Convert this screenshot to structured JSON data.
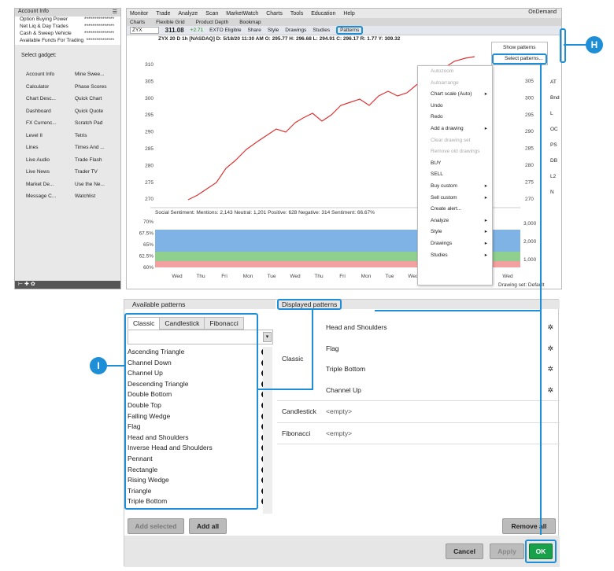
{
  "left_panel": {
    "header": "Account Info",
    "account_rows": [
      {
        "label": "Option Buying Power",
        "value": "***************"
      },
      {
        "label": "Net Liq & Day Trades",
        "value": "***************"
      },
      {
        "label": "Cash & Sweep Vehicle",
        "value": "***************"
      },
      {
        "label": "Available Funds For Trading",
        "value": "**************"
      }
    ],
    "select_gadget": "Select gadget:",
    "gadgets": [
      "Account Info",
      "Mine Swee...",
      "Calculator",
      "Phase Scores",
      "Chart Desc...",
      "Quick Chart",
      "Dashboard",
      "Quick Quote",
      "FX Currenc...",
      "Scratch Pad",
      "Level II",
      "Tetris",
      "Lines",
      "Times And ...",
      "Live Audio",
      "Trade Flash",
      "Live News",
      "Trader TV",
      "Market De...",
      "Use the Ne...",
      "Message C...",
      "Watchlist"
    ]
  },
  "chart": {
    "menu": [
      "Monitor",
      "Trade",
      "Analyze",
      "Scan",
      "MarketWatch",
      "Charts",
      "Tools",
      "Education",
      "Help"
    ],
    "ondemand": "OnDemand",
    "subtabs": [
      "Charts",
      "Flexible Grid",
      "Product Depth",
      "Bookmap"
    ],
    "symbol": "ZYX",
    "price": "311.08",
    "change": "+2.71",
    "toolbar": [
      "EXTO Eligible",
      "Share",
      "Style",
      "Drawings",
      "Studies",
      "Patterns"
    ],
    "infobar": "ZYX 20 D 1h [NASDAQ] D: 5/18/20 11:30 AM O: 295.77 H: 296.68 L: 294.91 C: 296.17 R: 1.77 Y: 309.32",
    "y_ticks": [
      "310",
      "305",
      "300",
      "295",
      "290",
      "285",
      "280",
      "275",
      "270"
    ],
    "sentiment_label": "Social Sentiment: Mentions: 2,143 Neutral: 1,201 Positive: 628 Negative: 314 Sentiment: 66.67%",
    "sent_ticks": [
      "70%",
      "67.5%",
      "65%",
      "62.5%",
      "60%"
    ],
    "vol_ticks": [
      "3,000",
      "2,000",
      "1,000"
    ],
    "x_ticks": [
      "Wed",
      "Thu",
      "Fri",
      "Mon",
      "Tue",
      "Wed",
      "Thu",
      "Fri",
      "Mon",
      "Tue",
      "Wed",
      "Thu",
      "Fri",
      "Mon",
      "Wed"
    ],
    "drawing_set": "Drawing set: Default",
    "right_tabs": [
      "AT",
      "Bnd",
      "L",
      "OC",
      "PS",
      "DB",
      "L2",
      "N"
    ],
    "context_menu": [
      "Autozoom",
      "Autoarrange",
      "Chart scale (Auto)",
      "Undo",
      "Redo",
      "Add a drawing",
      "Clear drawing set",
      "Remove old drawings",
      "BUY",
      "SELL",
      "Buy custom",
      "Sell custom",
      "Create alert...",
      "Analyze",
      "Style",
      "Drawings",
      "Studies"
    ],
    "pattern_menu": [
      "Show patterns",
      "Select patterns..."
    ]
  },
  "dialog": {
    "available_title": "Available patterns",
    "displayed_title": "Displayed patterns",
    "tabs": [
      "Classic",
      "Candlestick",
      "Fibonacci"
    ],
    "patterns": [
      "Ascending Triangle",
      "Channel Down",
      "Channel Up",
      "Descending Triangle",
      "Double Bottom",
      "Double Top",
      "Falling Wedge",
      "Flag",
      "Head and Shoulders",
      "Inverse Head and Shoulders",
      "Pennant",
      "Rectangle",
      "Rising Wedge",
      "Triangle",
      "Triple Bottom"
    ],
    "groups": [
      {
        "name": "Classic",
        "items": [
          "Head and Shoulders",
          "Flag",
          "Triple Bottom",
          "Channel Up"
        ]
      },
      {
        "name": "Candlestick",
        "items": [
          "<empty>"
        ]
      },
      {
        "name": "Fibonacci",
        "items": [
          "<empty>"
        ]
      }
    ],
    "add_selected": "Add selected",
    "add_all": "Add all",
    "remove_all": "Remove all",
    "cancel": "Cancel",
    "apply": "Apply",
    "ok": "OK"
  },
  "callouts": {
    "h": "H",
    "i": "I"
  }
}
